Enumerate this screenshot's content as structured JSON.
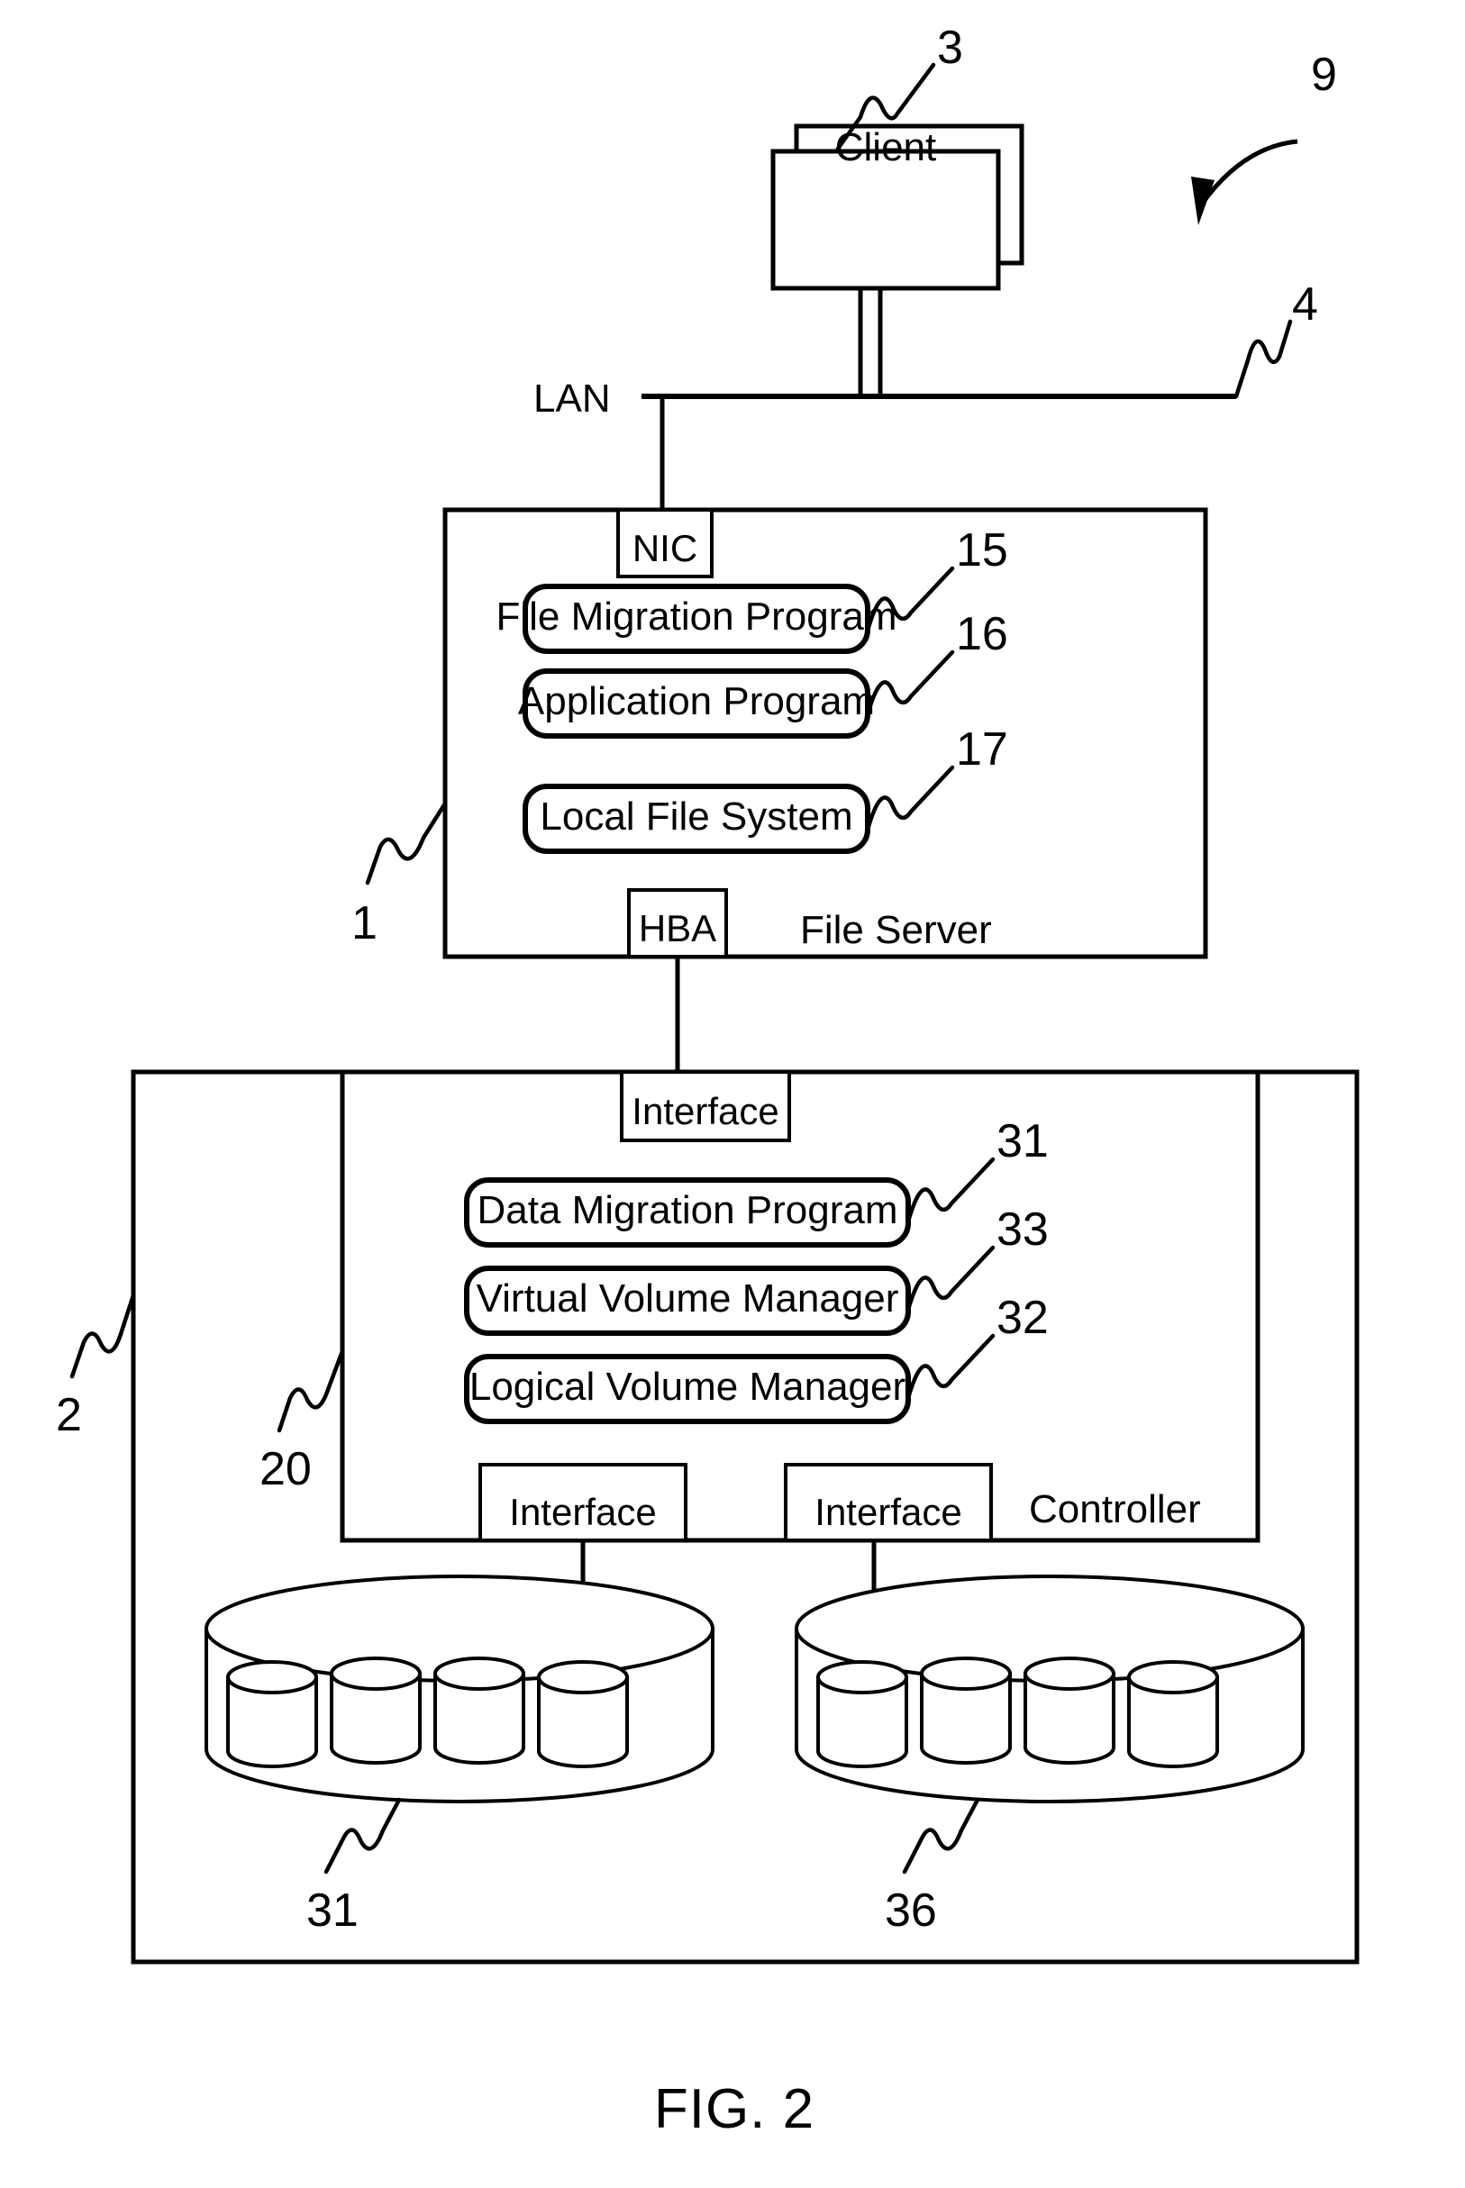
{
  "figure": {
    "caption": "FIG. 2",
    "system_ref": "9"
  },
  "client": {
    "label": "Client",
    "ref": "3"
  },
  "network": {
    "label": "LAN",
    "ref": "4"
  },
  "file_server": {
    "title": "File Server",
    "ref": "1",
    "nic": "NIC",
    "hba": "HBA",
    "modules": [
      {
        "label": "File Migration Program",
        "ref": "15"
      },
      {
        "label": "Application Program",
        "ref": "16"
      },
      {
        "label": "Local File System",
        "ref": "17"
      }
    ]
  },
  "storage_system": {
    "ref": "2",
    "controller": {
      "title": "Controller",
      "ref": "20",
      "top_interface": "Interface",
      "modules": [
        {
          "label": "Data Migration Program",
          "ref": "31"
        },
        {
          "label": "Virtual Volume Manager",
          "ref": "33"
        },
        {
          "label": "Logical Volume Manager",
          "ref": "32"
        }
      ],
      "bottom_interfaces": [
        {
          "label": "Interface"
        },
        {
          "label": "Interface"
        }
      ]
    },
    "disk_arrays": [
      {
        "ref": "31",
        "disk_count": 4
      },
      {
        "ref": "36",
        "disk_count": 4
      }
    ]
  }
}
